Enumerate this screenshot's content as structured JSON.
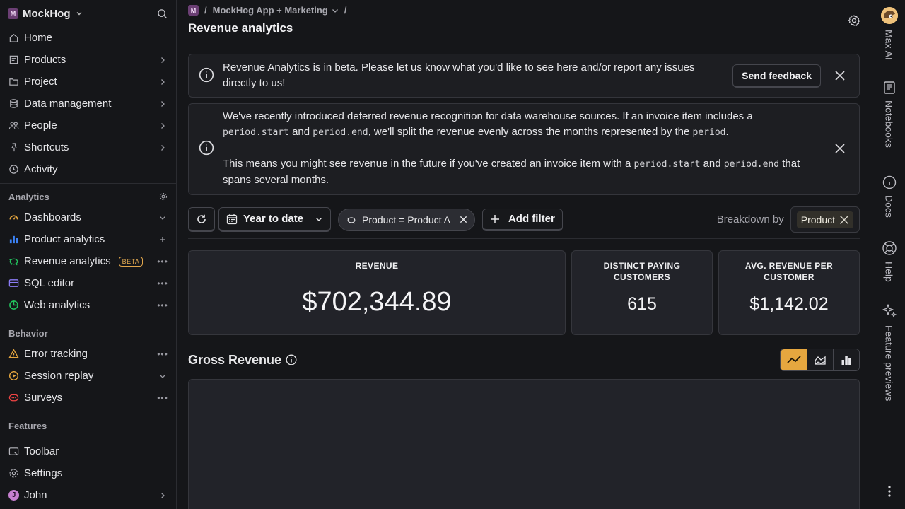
{
  "sidebar": {
    "org_badge": "M",
    "org_name": "MockHog",
    "nav": [
      {
        "label": "Home"
      },
      {
        "label": "Products"
      },
      {
        "label": "Project"
      },
      {
        "label": "Data management"
      },
      {
        "label": "People"
      },
      {
        "label": "Shortcuts"
      },
      {
        "label": "Activity"
      }
    ],
    "analytics_header": "Analytics",
    "analytics": [
      {
        "label": "Dashboards"
      },
      {
        "label": "Product analytics"
      },
      {
        "label": "Revenue analytics",
        "badge": "BETA"
      },
      {
        "label": "SQL editor"
      },
      {
        "label": "Web analytics"
      }
    ],
    "behavior_header": "Behavior",
    "behavior": [
      {
        "label": "Error tracking"
      },
      {
        "label": "Session replay"
      },
      {
        "label": "Surveys"
      }
    ],
    "features_header": "Features",
    "bottom": [
      {
        "label": "Toolbar"
      },
      {
        "label": "Settings"
      },
      {
        "label": "John",
        "avatar": "J"
      }
    ]
  },
  "breadcrumb": {
    "badge": "M",
    "project": "MockHog App + Marketing",
    "sep": "/"
  },
  "page_title": "Revenue analytics",
  "banners": {
    "beta_text": "Revenue Analytics is in beta. Please let us know what you'd like to see here and/or report any issues directly to us!",
    "feedback_button": "Send feedback",
    "deferred": {
      "p1_a": "We've recently introduced deferred revenue recognition for data warehouse sources. If an invoice item includes a ",
      "code1": "period.start",
      "p1_b": " and ",
      "code2": "period.end",
      "p1_c": ", we'll split the revenue evenly across the months represented by the ",
      "code3": "period",
      "p1_d": ".",
      "p2_a": "This means you might see revenue in the future if you've created an invoice item with a ",
      "code4": "period.start",
      "p2_b": " and ",
      "code5": "period.end",
      "p2_c": " that spans several months."
    }
  },
  "filters": {
    "date_range": "Year to date",
    "chip": "Product = Product A",
    "add_filter": "Add filter",
    "breakdown_label": "Breakdown by",
    "breakdown_value": "Product"
  },
  "stats": {
    "revenue_title": "REVENUE",
    "revenue_value": "$702,344.89",
    "customers_title": "DISTINCT PAYING CUSTOMERS",
    "customers_value": "615",
    "avg_title": "AVG. REVENUE PER CUSTOMER",
    "avg_value": "$1,142.02"
  },
  "gross": {
    "title": "Gross Revenue",
    "selected_view": "line"
  },
  "rail": [
    {
      "label": "Max AI"
    },
    {
      "label": "Notebooks"
    },
    {
      "label": "Docs"
    },
    {
      "label": "Help"
    },
    {
      "label": "Feature previews"
    }
  ],
  "colors": {
    "accent": "#e6a73f",
    "beta": "#e7ad53",
    "background": "#151619"
  }
}
